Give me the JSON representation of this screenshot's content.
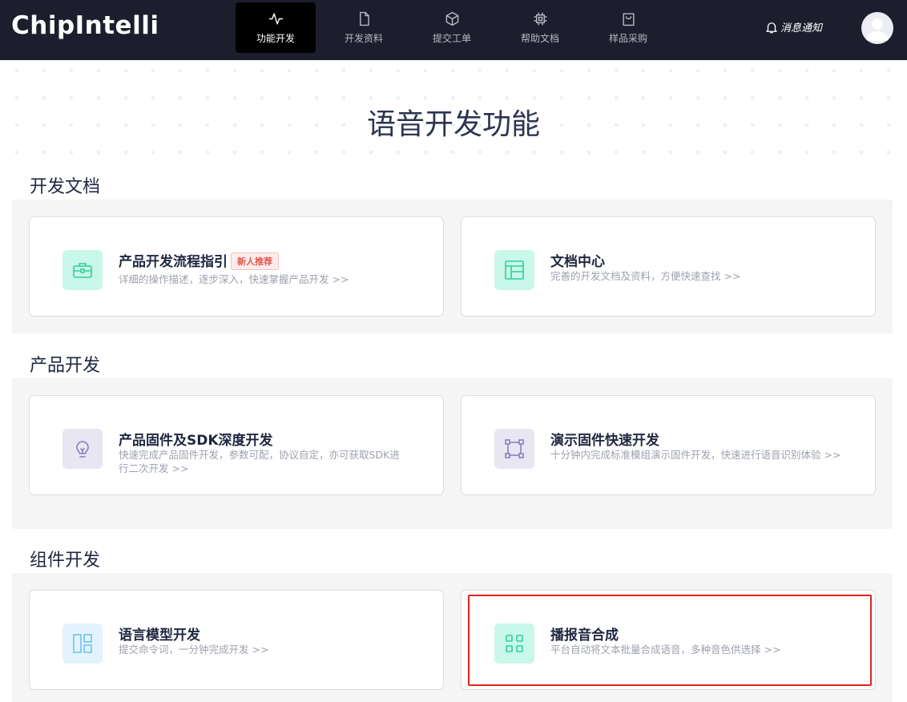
{
  "header": {
    "logo": "ChipIntelli",
    "nav": [
      {
        "label": "功能开发",
        "icon": "activity-icon",
        "active": true
      },
      {
        "label": "开发资料",
        "icon": "file-icon",
        "active": false
      },
      {
        "label": "提交工单",
        "icon": "box-icon",
        "active": false
      },
      {
        "label": "帮助文档",
        "icon": "chip-icon",
        "active": false
      },
      {
        "label": "样品采购",
        "icon": "shopping-bag-icon",
        "active": false
      }
    ],
    "notice": "消息通知",
    "avatar_icon": "user-avatar-icon"
  },
  "page": {
    "title": "语音开发功能"
  },
  "sections": [
    {
      "title": "开发文档",
      "cards": [
        {
          "title": "产品开发流程指引",
          "badge": "新人推荐",
          "desc": "详细的操作描述，逐步深入，快速掌握产品开发 >>",
          "icon": "toolbox-icon"
        },
        {
          "title": "文档中心",
          "desc": "完善的开发文档及资料，方便快速查找 >>",
          "icon": "layout-icon"
        }
      ]
    },
    {
      "title": "产品开发",
      "cards": [
        {
          "title": "产品固件及SDK深度开发",
          "desc": "快速完成产品固件开发，参数可配，协议自定，亦可获取SDK进行二次开发 >>",
          "icon": "lightbulb-icon"
        },
        {
          "title": "演示固件快速开发",
          "desc": "十分钟内完成标准模组演示固件开发，快速进行语音识别体验 >>",
          "icon": "frame-icon"
        }
      ]
    },
    {
      "title": "组件开发",
      "cards": [
        {
          "title": "语言模型开发",
          "desc": "提交命令词，一分钟完成开发 >>",
          "icon": "columns-icon"
        },
        {
          "title": "播报音合成",
          "desc": "平台自动将文本批量合成语音，多种音色供选择 >>",
          "icon": "grid-icon"
        }
      ]
    }
  ],
  "colors": {
    "topbar": "#1c1e2d",
    "green_icon_bg": "#c9f7e9",
    "purple_icon_bg": "#e8e6f3",
    "blue_icon_bg": "#e3f3fd",
    "highlight": "#e0241a"
  }
}
